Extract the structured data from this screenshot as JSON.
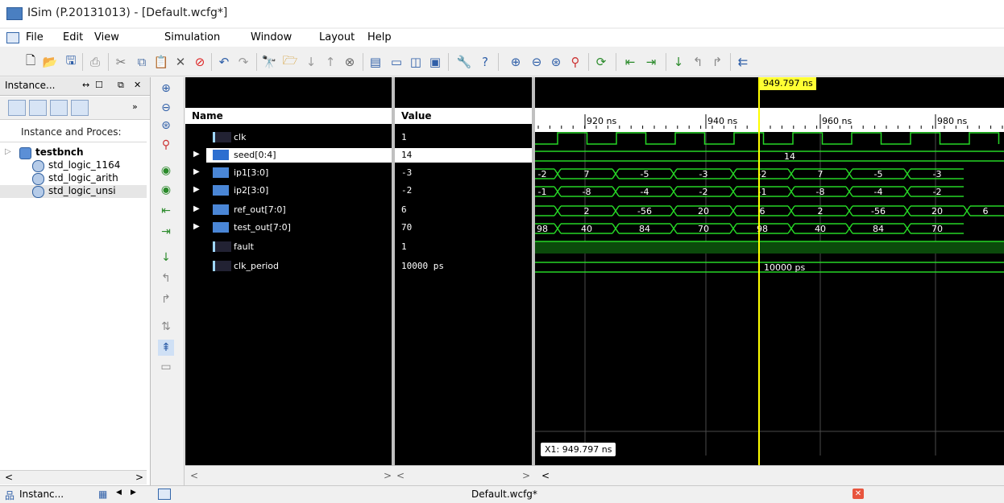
{
  "window": {
    "title": "ISim (P.20131013) - [Default.wcfg*]"
  },
  "menu": [
    "File",
    "Edit",
    "View",
    "Simulation",
    "Window",
    "Layout",
    "Help"
  ],
  "instance_panel": {
    "title": "Instance...",
    "header": "Instance and Proces:",
    "tree": [
      "testbnch",
      "std_logic_1164",
      "std_logic_arith",
      "std_logic_unsi"
    ]
  },
  "bottom_tabs": {
    "instance_tab": "Instanc...",
    "document": "Default.wcfg*"
  },
  "columns": {
    "name": "Name",
    "value": "Value"
  },
  "signals": [
    {
      "name": "clk",
      "value": "1",
      "type": "bit"
    },
    {
      "name": "seed[0:4]",
      "value": "14",
      "type": "bus",
      "selected": true
    },
    {
      "name": "ip1[3:0]",
      "value": "-3",
      "type": "bus"
    },
    {
      "name": "ip2[3:0]",
      "value": "-2",
      "type": "bus"
    },
    {
      "name": "ref_out[7:0]",
      "value": "6",
      "type": "bus"
    },
    {
      "name": "test_out[7:0]",
      "value": "70",
      "type": "bus"
    },
    {
      "name": "fault",
      "value": "1",
      "type": "bit"
    },
    {
      "name": "clk_period",
      "value": "10000 ps",
      "type": "bit"
    }
  ],
  "wave": {
    "cursor_time": "949.797 ns",
    "x1_label": "X1: 949.797 ns",
    "time_labels": [
      "920 ns",
      "940 ns",
      "960 ns",
      "980 ns"
    ],
    "bus_values": {
      "seed": [
        "14"
      ],
      "ip1": [
        "-2",
        "7",
        "-5",
        "-3",
        "-2",
        "7",
        "-5",
        "-3"
      ],
      "ip2": [
        "-1",
        "-8",
        "-4",
        "-2",
        "-1",
        "-8",
        "-4",
        "-2"
      ],
      "ref_out": [
        "6",
        "2",
        "-56",
        "20",
        "6",
        "2",
        "-56",
        "20",
        "6"
      ],
      "test_out": [
        "98",
        "40",
        "84",
        "70",
        "98",
        "40",
        "84",
        "70"
      ],
      "clk_period": [
        "10000 ps"
      ]
    },
    "colors": {
      "wave": "#26d626",
      "cursor": "#ffff00",
      "grid": "#4a4a4a",
      "background": "#000000"
    }
  }
}
